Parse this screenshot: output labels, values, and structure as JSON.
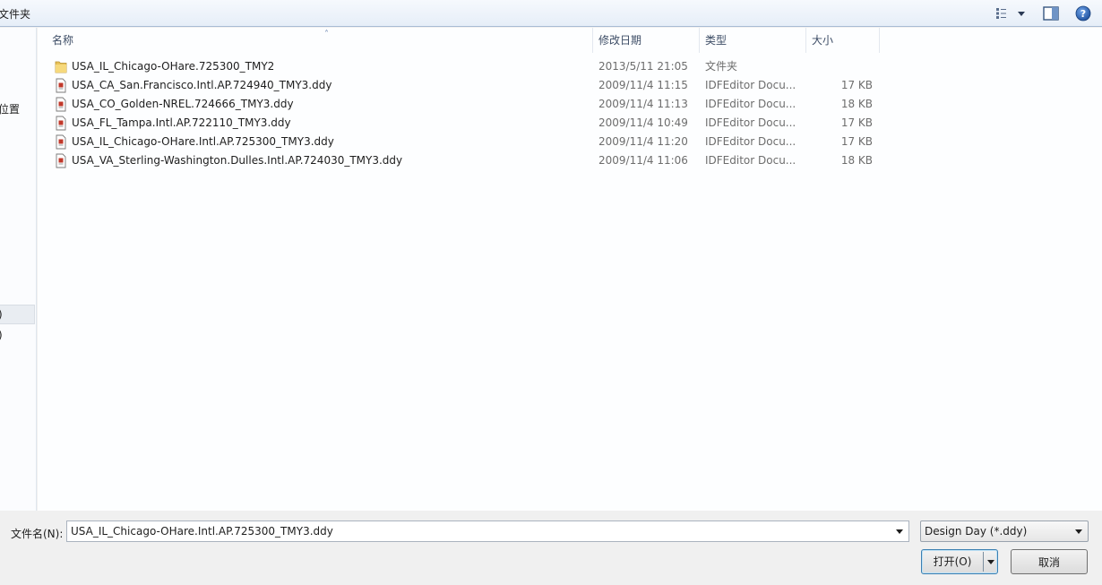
{
  "toolbar": {
    "new_folder_label": "文件夹",
    "views_icon": "views-icon",
    "preview_pane_icon": "preview-pane-icon",
    "help_icon": "help-icon"
  },
  "nav": {
    "fragments": [
      {
        "text": "位置"
      },
      {
        "text": ")"
      },
      {
        "text": ")"
      }
    ]
  },
  "columns": {
    "name": "名称",
    "date": "修改日期",
    "type": "类型",
    "size": "大小"
  },
  "files": [
    {
      "name": "USA_IL_Chicago-OHare.725300_TMY2",
      "date": "2013/5/11 21:05",
      "type": "文件夹",
      "size": "",
      "icon": "folder-icon"
    },
    {
      "name": "USA_CA_San.Francisco.Intl.AP.724940_TMY3.ddy",
      "date": "2009/11/4 11:15",
      "type": "IDFEditor Docu...",
      "size": "17 KB",
      "icon": "file-icon"
    },
    {
      "name": "USA_CO_Golden-NREL.724666_TMY3.ddy",
      "date": "2009/11/4 11:13",
      "type": "IDFEditor Docu...",
      "size": "18 KB",
      "icon": "file-icon"
    },
    {
      "name": "USA_FL_Tampa.Intl.AP.722110_TMY3.ddy",
      "date": "2009/11/4 10:49",
      "type": "IDFEditor Docu...",
      "size": "17 KB",
      "icon": "file-icon"
    },
    {
      "name": "USA_IL_Chicago-OHare.Intl.AP.725300_TMY3.ddy",
      "date": "2009/11/4 11:20",
      "type": "IDFEditor Docu...",
      "size": "17 KB",
      "icon": "file-icon"
    },
    {
      "name": "USA_VA_Sterling-Washington.Dulles.Intl.AP.724030_TMY3.ddy",
      "date": "2009/11/4 11:06",
      "type": "IDFEditor Docu...",
      "size": "18 KB",
      "icon": "file-icon"
    }
  ],
  "bottom": {
    "filename_label": "文件名(N):",
    "filename_value": "USA_IL_Chicago-OHare.Intl.AP.725300_TMY3.ddy",
    "filter_value": "Design Day (*.ddy)",
    "open_label": "打开(O)",
    "cancel_label": "取消"
  }
}
